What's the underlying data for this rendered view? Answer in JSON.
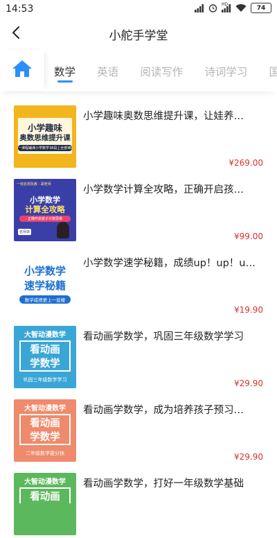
{
  "status_bar": {
    "time": "14:53",
    "network_label": "HD",
    "battery": "74",
    "icons": [
      "signal-icon",
      "alarm-icon",
      "signal-hd-icon",
      "wifi-icon",
      "battery-icon"
    ]
  },
  "header": {
    "title": "小舵手学堂",
    "back_icon": "back-arrow-icon"
  },
  "tabs": {
    "home_icon": "home-icon",
    "accent": "#2c8ef8",
    "items": [
      {
        "label": "数学",
        "active": true
      },
      {
        "label": "英语",
        "active": false
      },
      {
        "label": "阅读写作",
        "active": false
      },
      {
        "label": "诗词学习",
        "active": false
      },
      {
        "label": "国学",
        "active": false
      }
    ]
  },
  "courses": [
    {
      "title": "小学趣味奥数思维提升课，让娃养…",
      "price": "¥269.00",
      "thumb": {
        "line1": "小学趣味",
        "line2": "奥数思维提升课",
        "sub": "一课程辅课小学数学38段上全部难题"
      }
    },
    {
      "title": "小学数学计算全攻略，正确开启孩…",
      "price": "¥99.00",
      "thumb": {
        "top": "一线名校执教 · 胡老师",
        "line1": "小学数学",
        "line2": "计算全攻略",
        "sub": "正确开启孩子计算思维",
        "badge": "名师讲"
      }
    },
    {
      "title": "小学数学速学秘籍，成绩up！up！u…",
      "price": "¥19.90",
      "thumb": {
        "line1": "小学数学",
        "line2": "速学秘籍",
        "sub": "数学成绩更上一层楼"
      }
    },
    {
      "title": "看动画学数学，巩固三年级数学学习",
      "price": "¥29.90",
      "thumb": {
        "top": "大智动漫数学",
        "line1": "看动画",
        "line2": "学数学",
        "sub": "巩固三年级数学学习"
      }
    },
    {
      "title": "看动画学数学，成为培养孩子预习…",
      "price": "¥29.90",
      "thumb": {
        "top": "大智动漫数学",
        "line1": "看动画",
        "line2": "学数学",
        "sub": "二年级数学提分快"
      }
    },
    {
      "title": "看动画学数学，打好一年级数学基础",
      "price": "",
      "thumb": {
        "top": "大智动漫数学",
        "line1": "看动画",
        "line2": "",
        "sub": ""
      }
    }
  ],
  "colors": {
    "price": "#d9322e",
    "thumb1_bg": "#f2b51e",
    "thumb2_bg": "#3a3fa8",
    "thumb4_bg": "#3aa6d6",
    "thumb5_bg": "#ef8a6c",
    "thumb6_bg": "#5cb85c"
  }
}
